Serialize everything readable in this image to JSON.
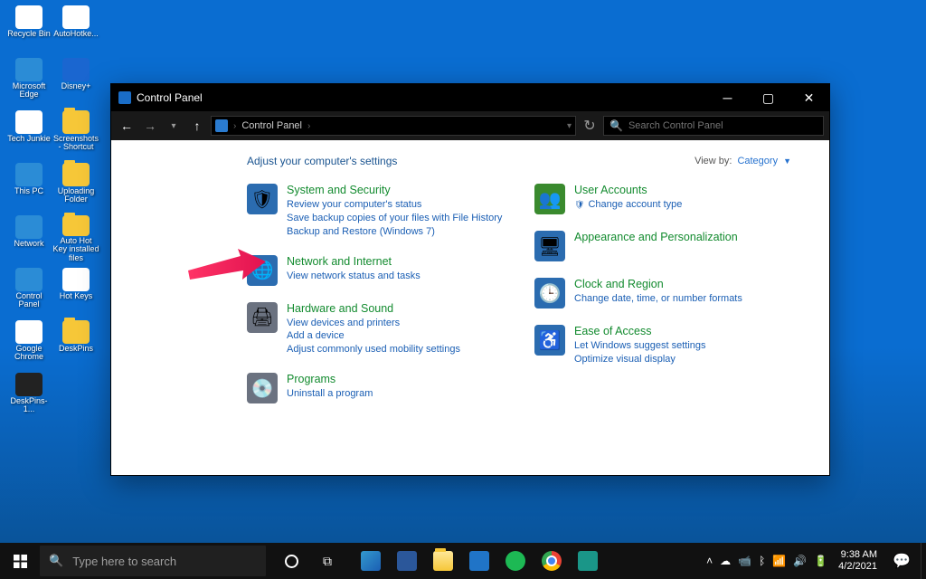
{
  "desktop": {
    "col1": [
      {
        "label": "Recycle Bin",
        "bg": "#fff"
      },
      {
        "label": "Microsoft Edge",
        "bg": "#2b8cd6"
      },
      {
        "label": "Tech Junkie",
        "bg": "#fff"
      },
      {
        "label": "This PC",
        "bg": "#2b8cd6"
      },
      {
        "label": "Network",
        "bg": "#2b8cd6"
      },
      {
        "label": "Control Panel",
        "bg": "#2b8cd6"
      },
      {
        "label": "Google Chrome",
        "bg": "#fff"
      },
      {
        "label": "DeskPins-1...",
        "bg": "#222"
      }
    ],
    "col2": [
      {
        "label": "AutoHotke...",
        "bg": "#fff"
      },
      {
        "label": "Disney+",
        "bg": "#1a66d0"
      },
      {
        "label": "Screenshots - Shortcut",
        "bg": "#f6c738"
      },
      {
        "label": "Uploading Folder",
        "bg": "#f6c738"
      },
      {
        "label": "Auto Hot Key installed files",
        "bg": "#f6c738"
      },
      {
        "label": "Hot Keys",
        "bg": "#fff"
      },
      {
        "label": "DeskPins",
        "bg": "#f6c738"
      }
    ]
  },
  "window": {
    "title": "Control Panel",
    "breadcrumb": "Control Panel",
    "addr_dd": "▾",
    "refresh": "↻",
    "search_placeholder": "Search Control Panel",
    "header": "Adjust your computer's settings",
    "viewby_label": "View by:",
    "viewby_value": "Category",
    "colA": [
      {
        "title": "System and Security",
        "icon_bg": "#2b6cb0",
        "glyph": "🛡",
        "links": [
          "Review your computer's status",
          "Save backup copies of your files with File History",
          "Backup and Restore (Windows 7)"
        ]
      },
      {
        "title": "Network and Internet",
        "icon_bg": "#2b6cb0",
        "glyph": "🌐",
        "links": [
          "View network status and tasks"
        ]
      },
      {
        "title": "Hardware and Sound",
        "icon_bg": "#6b7280",
        "glyph": "🖨",
        "links": [
          "View devices and printers",
          "Add a device",
          "Adjust commonly used mobility settings"
        ]
      },
      {
        "title": "Programs",
        "icon_bg": "#6b7280",
        "glyph": "💿",
        "links": [
          "Uninstall a program"
        ]
      }
    ],
    "colB": [
      {
        "title": "User Accounts",
        "icon_bg": "#3a8a2e",
        "glyph": "👥",
        "links": [
          "Change account type"
        ],
        "shield": [
          true
        ]
      },
      {
        "title": "Appearance and Personalization",
        "icon_bg": "#2b6cb0",
        "glyph": "🖥",
        "links": []
      },
      {
        "title": "Clock and Region",
        "icon_bg": "#2b6cb0",
        "glyph": "🕒",
        "links": [
          "Change date, time, or number formats"
        ]
      },
      {
        "title": "Ease of Access",
        "icon_bg": "#2b6cb0",
        "glyph": "♿",
        "links": [
          "Let Windows suggest settings",
          "Optimize visual display"
        ]
      }
    ]
  },
  "taskbar": {
    "search_placeholder": "Type here to search",
    "time": "9:38 AM",
    "date": "4/2/2021"
  }
}
